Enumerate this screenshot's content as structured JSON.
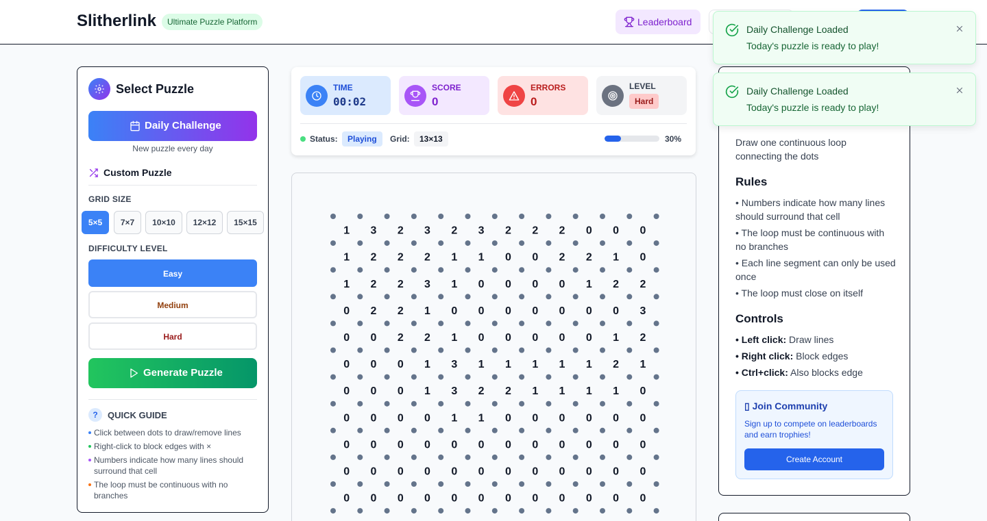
{
  "header": {
    "brand": "Slitherlink",
    "badge": "Ultimate Puzzle Platform",
    "leaderboard_label": "Leaderboard"
  },
  "left_panel": {
    "title": "Select Puzzle",
    "daily_button": "Daily Challenge",
    "daily_sub": "New puzzle every day",
    "custom_title": "Custom Puzzle",
    "grid_size_label": "GRID SIZE",
    "grid_sizes": [
      "5×5",
      "7×7",
      "10×10",
      "12×12",
      "15×15"
    ],
    "selected_grid_size": "5×5",
    "difficulty_label": "DIFFICULTY LEVEL",
    "difficulties": [
      "Easy",
      "Medium",
      "Hard"
    ],
    "selected_difficulty": "Easy",
    "generate_button": "Generate Puzzle",
    "quick_guide_icon": "?",
    "quick_guide_title": "QUICK GUIDE",
    "quick_guide_items": [
      {
        "text": "Click between dots to draw/remove lines",
        "color": "#3b82f6"
      },
      {
        "text": "Right-click to block edges with ×",
        "color": "#22c55e"
      },
      {
        "text": "Numbers indicate how many lines should surround that cell",
        "color": "#a855f7"
      },
      {
        "text": "The loop must be continuous with no branches",
        "color": "#f97316"
      }
    ]
  },
  "status": {
    "time_label": "TIME",
    "time_value": "00:02",
    "score_label": "SCORE",
    "score_value": "0",
    "errors_label": "ERRORS",
    "errors_value": "0",
    "level_label": "LEVEL",
    "level_value": "Hard",
    "status_label": "Status:",
    "status_value": "Playing",
    "grid_label": "Grid:",
    "grid_value": "13×13",
    "progress_percent": 30,
    "progress_text": "30%"
  },
  "board": {
    "rows": [
      [
        "1",
        "3",
        "2",
        "3",
        "2",
        "3",
        "2",
        "2",
        "2",
        "0",
        "0",
        "0"
      ],
      [
        "1",
        "2",
        "2",
        "2",
        "1",
        "1",
        "0",
        "0",
        "2",
        "2",
        "1",
        "0"
      ],
      [
        "1",
        "2",
        "2",
        "3",
        "1",
        "0",
        "0",
        "0",
        "0",
        "1",
        "2",
        "2"
      ],
      [
        "0",
        "2",
        "2",
        "1",
        "0",
        "0",
        "0",
        "0",
        "0",
        "0",
        "0",
        "3"
      ],
      [
        "0",
        "0",
        "2",
        "2",
        "1",
        "0",
        "0",
        "0",
        "0",
        "0",
        "1",
        "2"
      ],
      [
        "0",
        "0",
        "0",
        "1",
        "3",
        "1",
        "1",
        "1",
        "1",
        "1",
        "2",
        "1"
      ],
      [
        "0",
        "0",
        "0",
        "1",
        "3",
        "2",
        "2",
        "1",
        "1",
        "1",
        "1",
        "0"
      ],
      [
        "0",
        "0",
        "0",
        "0",
        "1",
        "1",
        "0",
        "0",
        "0",
        "0",
        "0",
        "0"
      ],
      [
        "0",
        "0",
        "0",
        "0",
        "0",
        "0",
        "0",
        "0",
        "0",
        "0",
        "0",
        "0"
      ],
      [
        "0",
        "0",
        "0",
        "0",
        "0",
        "0",
        "0",
        "0",
        "0",
        "0",
        "0",
        "0"
      ],
      [
        "0",
        "0",
        "0",
        "0",
        "0",
        "0",
        "0",
        "0",
        "0",
        "0",
        "0",
        "0"
      ]
    ],
    "dot_color": "#64748b",
    "number_color": "#111827"
  },
  "right_panel": {
    "goal": "Draw one continuous loop connecting the dots",
    "rules_title": "Rules",
    "rules": [
      "• Numbers indicate how many lines should surround that cell",
      "• The loop must be continuous with no branches",
      "• Each line segment can only be used once",
      "• The loop must close on itself"
    ],
    "controls_title": "Controls",
    "controls": [
      {
        "key": "• Left click:",
        "desc": " Draw lines"
      },
      {
        "key": "• Right click:",
        "desc": " Block edges"
      },
      {
        "key": "• Ctrl+click:",
        "desc": " Also blocks edge"
      }
    ],
    "community_title": "▯ Join Community",
    "community_text": "Sign up to compete on leaderboards and earn trophies!",
    "community_button": "Create Account"
  },
  "toasts": [
    {
      "title": "Daily Challenge Loaded",
      "desc": "Today's puzzle is ready to play!"
    },
    {
      "title": "Daily Challenge Loaded",
      "desc": "Today's puzzle is ready to play!"
    }
  ]
}
